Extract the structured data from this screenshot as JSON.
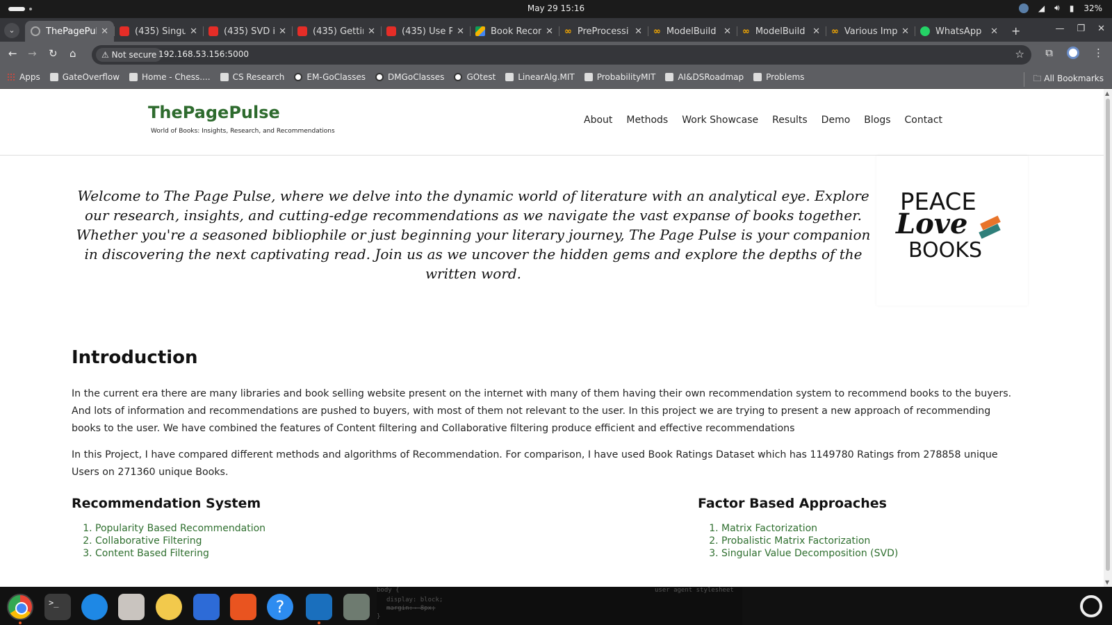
{
  "system": {
    "datetime": "May 29  15:16",
    "battery": "32%"
  },
  "tabs": [
    {
      "title": "ThePagePul",
      "icon": "globe",
      "active": true
    },
    {
      "title": "(435) Singul",
      "icon": "youtube"
    },
    {
      "title": "(435) SVD in",
      "icon": "youtube"
    },
    {
      "title": "(435) Gettin",
      "icon": "youtube"
    },
    {
      "title": "(435) Use Py",
      "icon": "youtube"
    },
    {
      "title": "Book Recom",
      "icon": "drive"
    },
    {
      "title": "PreProcessi",
      "icon": "colab"
    },
    {
      "title": "ModelBuild",
      "icon": "colab"
    },
    {
      "title": "ModelBuild",
      "icon": "colab"
    },
    {
      "title": "Various Imp",
      "icon": "colab"
    },
    {
      "title": "WhatsApp",
      "icon": "whatsapp"
    }
  ],
  "toolbar": {
    "not_secure": "Not secure",
    "url": "192.168.53.156:5000"
  },
  "bookmarks": {
    "items": [
      "Apps",
      "GateOverflow",
      "Home - Chess....",
      "CS Research",
      "EM-GoClasses",
      "DMGoClasses",
      "GOtest",
      "LinearAlg.MIT",
      "ProbabilityMIT",
      "AI&DSRoadmap",
      "Problems"
    ],
    "all": "All Bookmarks"
  },
  "site": {
    "title": "ThePagePulse",
    "subtitle": "World of Books: Insights, Research, and Recommendations",
    "nav": [
      "About",
      "Methods",
      "Work Showcase",
      "Results",
      "Demo",
      "Blogs",
      "Contact"
    ]
  },
  "hero": {
    "text": "Welcome to The Page Pulse, where we delve into the dynamic world of literature with an analytical eye. Explore our research, insights, and cutting-edge recommendations as we navigate the vast expanse of books together. Whether you're a seasoned bibliophile or just beginning your literary journey, The Page Pulse is your companion in discovering the next captivating read. Join us as we uncover the hidden gems and explore the depths of the written word.",
    "logo_lines": [
      "PEACE",
      "Love",
      "BOOKS"
    ]
  },
  "intro": {
    "heading": "Introduction",
    "p1": "In the current era there are many libraries and book selling website present on the internet with many of them having their own recommendation system to recommend books to the buyers. And lots of information and recommendations are pushed to buyers, with most of them not relevant to the user. In this project we are trying to present a new approach of recommending books to the user. We have combined the features of Content filtering and Collaborative filtering produce efficient and effective recommendations",
    "p2": "In this Project, I have compared different methods and algorithms of Recommendation. For comparison, I have used Book Ratings Dataset which has 1149780 Ratings from 278858 unique Users on 271360 unique Books."
  },
  "recommendation": {
    "heading": "Recommendation System",
    "items": [
      "Popularity Based Recommendation",
      "Collaborative Filtering",
      "Content Based Filtering"
    ]
  },
  "factor": {
    "heading": "Factor Based Approaches",
    "items": [
      "Matrix Factorization",
      "Probalistic Matrix Factorization",
      "Singular Value Decomposition (SVD)"
    ]
  },
  "dock_code": [
    "body {",
    "display: block;",
    "margin:→ 8px;",
    "}",
    "user agent stylesheet"
  ],
  "colors": {
    "brand_green": "#2e6b2e",
    "link_green": "#2f6f2f",
    "chrome_dark": "#35363a",
    "chrome_mid": "#5d5e62"
  }
}
